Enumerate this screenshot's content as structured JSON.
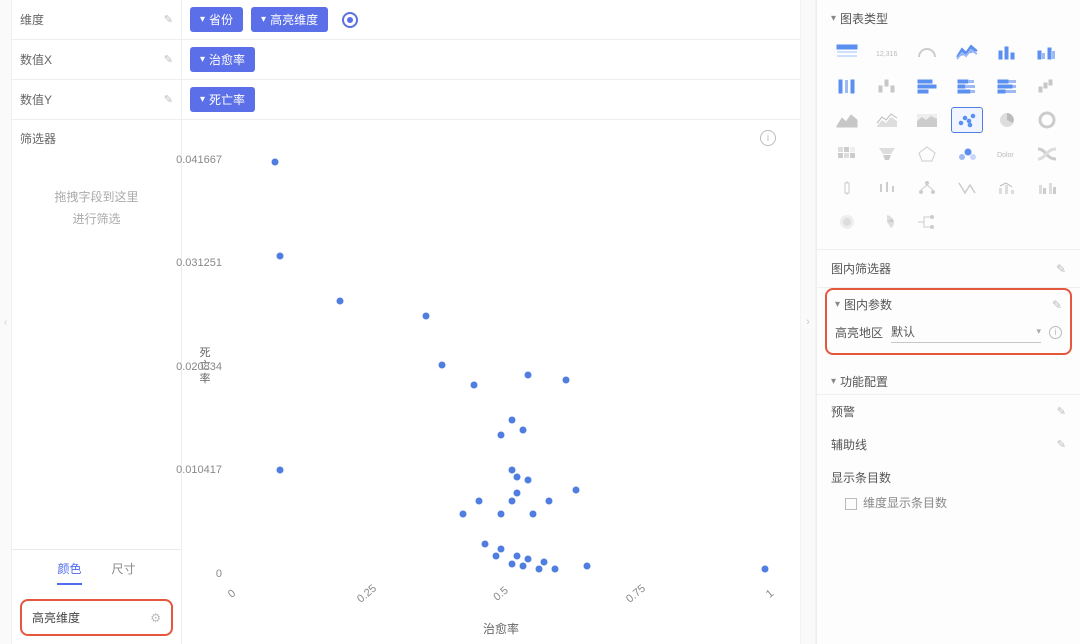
{
  "config": {
    "dimension_label": "维度",
    "valuex_label": "数值X",
    "valuey_label": "数值Y",
    "filter_label": "筛选器",
    "filter_drop_line1": "拖拽字段到这里",
    "filter_drop_line2": "进行筛选"
  },
  "pills": {
    "province": "省份",
    "highlight_dim": "高亮维度",
    "cure_rate": "治愈率",
    "death_rate": "死亡率"
  },
  "tabs": {
    "color": "颜色",
    "size": "尺寸"
  },
  "highlight_field": "高亮维度",
  "chart_types_hd": "图表类型",
  "in_filter_hd": "图内筛选器",
  "in_param_hd": "图内参数",
  "param_label": "高亮地区",
  "param_value": "默认",
  "fn_config_hd": "功能配置",
  "fn_alert": "预警",
  "fn_aux": "辅助线",
  "fn_count_hd": "显示条目数",
  "fn_count_chk": "维度显示条目数",
  "chart_data": {
    "type": "scatter",
    "xlabel": "治愈率",
    "ylabel": "死亡率",
    "xlim": [
      0,
      1
    ],
    "ylim": [
      0,
      0.041667
    ],
    "x_ticks": [
      "0",
      "0.25",
      "0.5",
      "0.75",
      "1"
    ],
    "y_ticks": [
      "0",
      "0.010417",
      "0.020834",
      "0.031251",
      "0.041667"
    ],
    "series": [
      {
        "name": "省份",
        "points": [
          {
            "x": 0.08,
            "y": 0.0415
          },
          {
            "x": 0.2,
            "y": 0.0275
          },
          {
            "x": 0.09,
            "y": 0.032
          },
          {
            "x": 0.36,
            "y": 0.026
          },
          {
            "x": 0.39,
            "y": 0.021
          },
          {
            "x": 0.45,
            "y": 0.019
          },
          {
            "x": 0.55,
            "y": 0.02
          },
          {
            "x": 0.62,
            "y": 0.0195
          },
          {
            "x": 0.5,
            "y": 0.014
          },
          {
            "x": 0.52,
            "y": 0.0155
          },
          {
            "x": 0.54,
            "y": 0.0145
          },
          {
            "x": 0.52,
            "y": 0.0105
          },
          {
            "x": 0.53,
            "y": 0.0098
          },
          {
            "x": 0.55,
            "y": 0.0095
          },
          {
            "x": 0.09,
            "y": 0.0105
          },
          {
            "x": 0.43,
            "y": 0.006
          },
          {
            "x": 0.46,
            "y": 0.0073
          },
          {
            "x": 0.5,
            "y": 0.006
          },
          {
            "x": 0.52,
            "y": 0.0073
          },
          {
            "x": 0.53,
            "y": 0.0082
          },
          {
            "x": 0.56,
            "y": 0.006
          },
          {
            "x": 0.59,
            "y": 0.0073
          },
          {
            "x": 0.64,
            "y": 0.0085
          },
          {
            "x": 0.47,
            "y": 0.003
          },
          {
            "x": 0.49,
            "y": 0.0018
          },
          {
            "x": 0.5,
            "y": 0.0025
          },
          {
            "x": 0.52,
            "y": 0.001
          },
          {
            "x": 0.53,
            "y": 0.0018
          },
          {
            "x": 0.54,
            "y": 0.0008
          },
          {
            "x": 0.55,
            "y": 0.0015
          },
          {
            "x": 0.57,
            "y": 0.0005
          },
          {
            "x": 0.58,
            "y": 0.0012
          },
          {
            "x": 0.6,
            "y": 0.0005
          },
          {
            "x": 0.66,
            "y": 0.0008
          },
          {
            "x": 0.99,
            "y": 0.0005
          }
        ]
      }
    ]
  }
}
